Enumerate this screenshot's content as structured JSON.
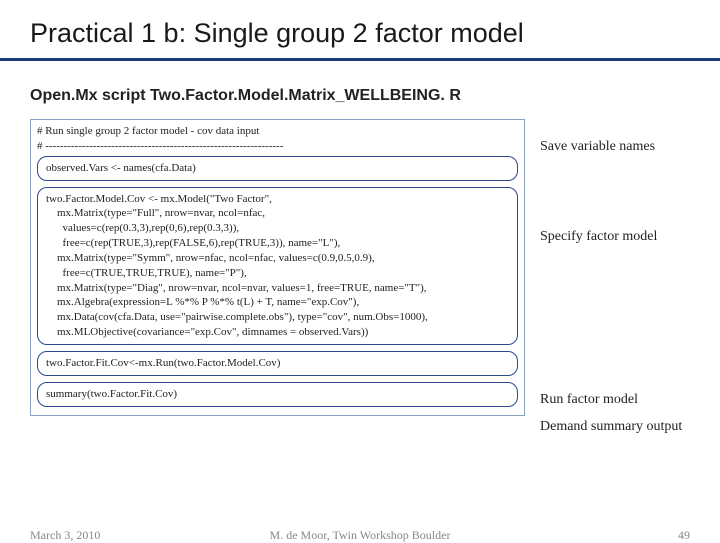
{
  "title": "Practical 1 b: Single group 2 factor model",
  "subtitle_prefix": "Open.Mx script ",
  "subtitle_script": "Two.Factor.Model.Matrix_WELLBEING. R",
  "code": {
    "comment1": "# Run single group 2 factor model - cov data input",
    "comment2": "# -----------------------------------------------------------------",
    "block1": "observed.Vars <- names(cfa.Data)",
    "block2": "two.Factor.Model.Cov <- mx.Model(\"Two Factor\",\n    mx.Matrix(type=\"Full\", nrow=nvar, ncol=nfac,\n      values=c(rep(0.3,3),rep(0,6),rep(0.3,3)),\n      free=c(rep(TRUE,3),rep(FALSE,6),rep(TRUE,3)), name=\"L\"),\n    mx.Matrix(type=\"Symm\", nrow=nfac, ncol=nfac, values=c(0.9,0.5,0.9),\n      free=c(TRUE,TRUE,TRUE), name=\"P\"),\n    mx.Matrix(type=\"Diag\", nrow=nvar, ncol=nvar, values=1, free=TRUE, name=\"T\"),\n    mx.Algebra(expression=L %*% P %*% t(L) + T, name=\"exp.Cov\"),\n    mx.Data(cov(cfa.Data, use=\"pairwise.complete.obs\"), type=\"cov\", num.Obs=1000),\n    mx.MLObjective(covariance=\"exp.Cov\", dimnames = observed.Vars))",
    "block3": "two.Factor.Fit.Cov<-mx.Run(two.Factor.Model.Cov)",
    "block4": "summary(two.Factor.Fit.Cov)"
  },
  "annotations": {
    "a1": "Save variable names",
    "a2": "Specify factor model",
    "a3": "Run factor model",
    "a4": "Demand summary output"
  },
  "footer": {
    "date": "March 3, 2010",
    "author": "M. de Moor, Twin Workshop Boulder",
    "page": "49"
  }
}
